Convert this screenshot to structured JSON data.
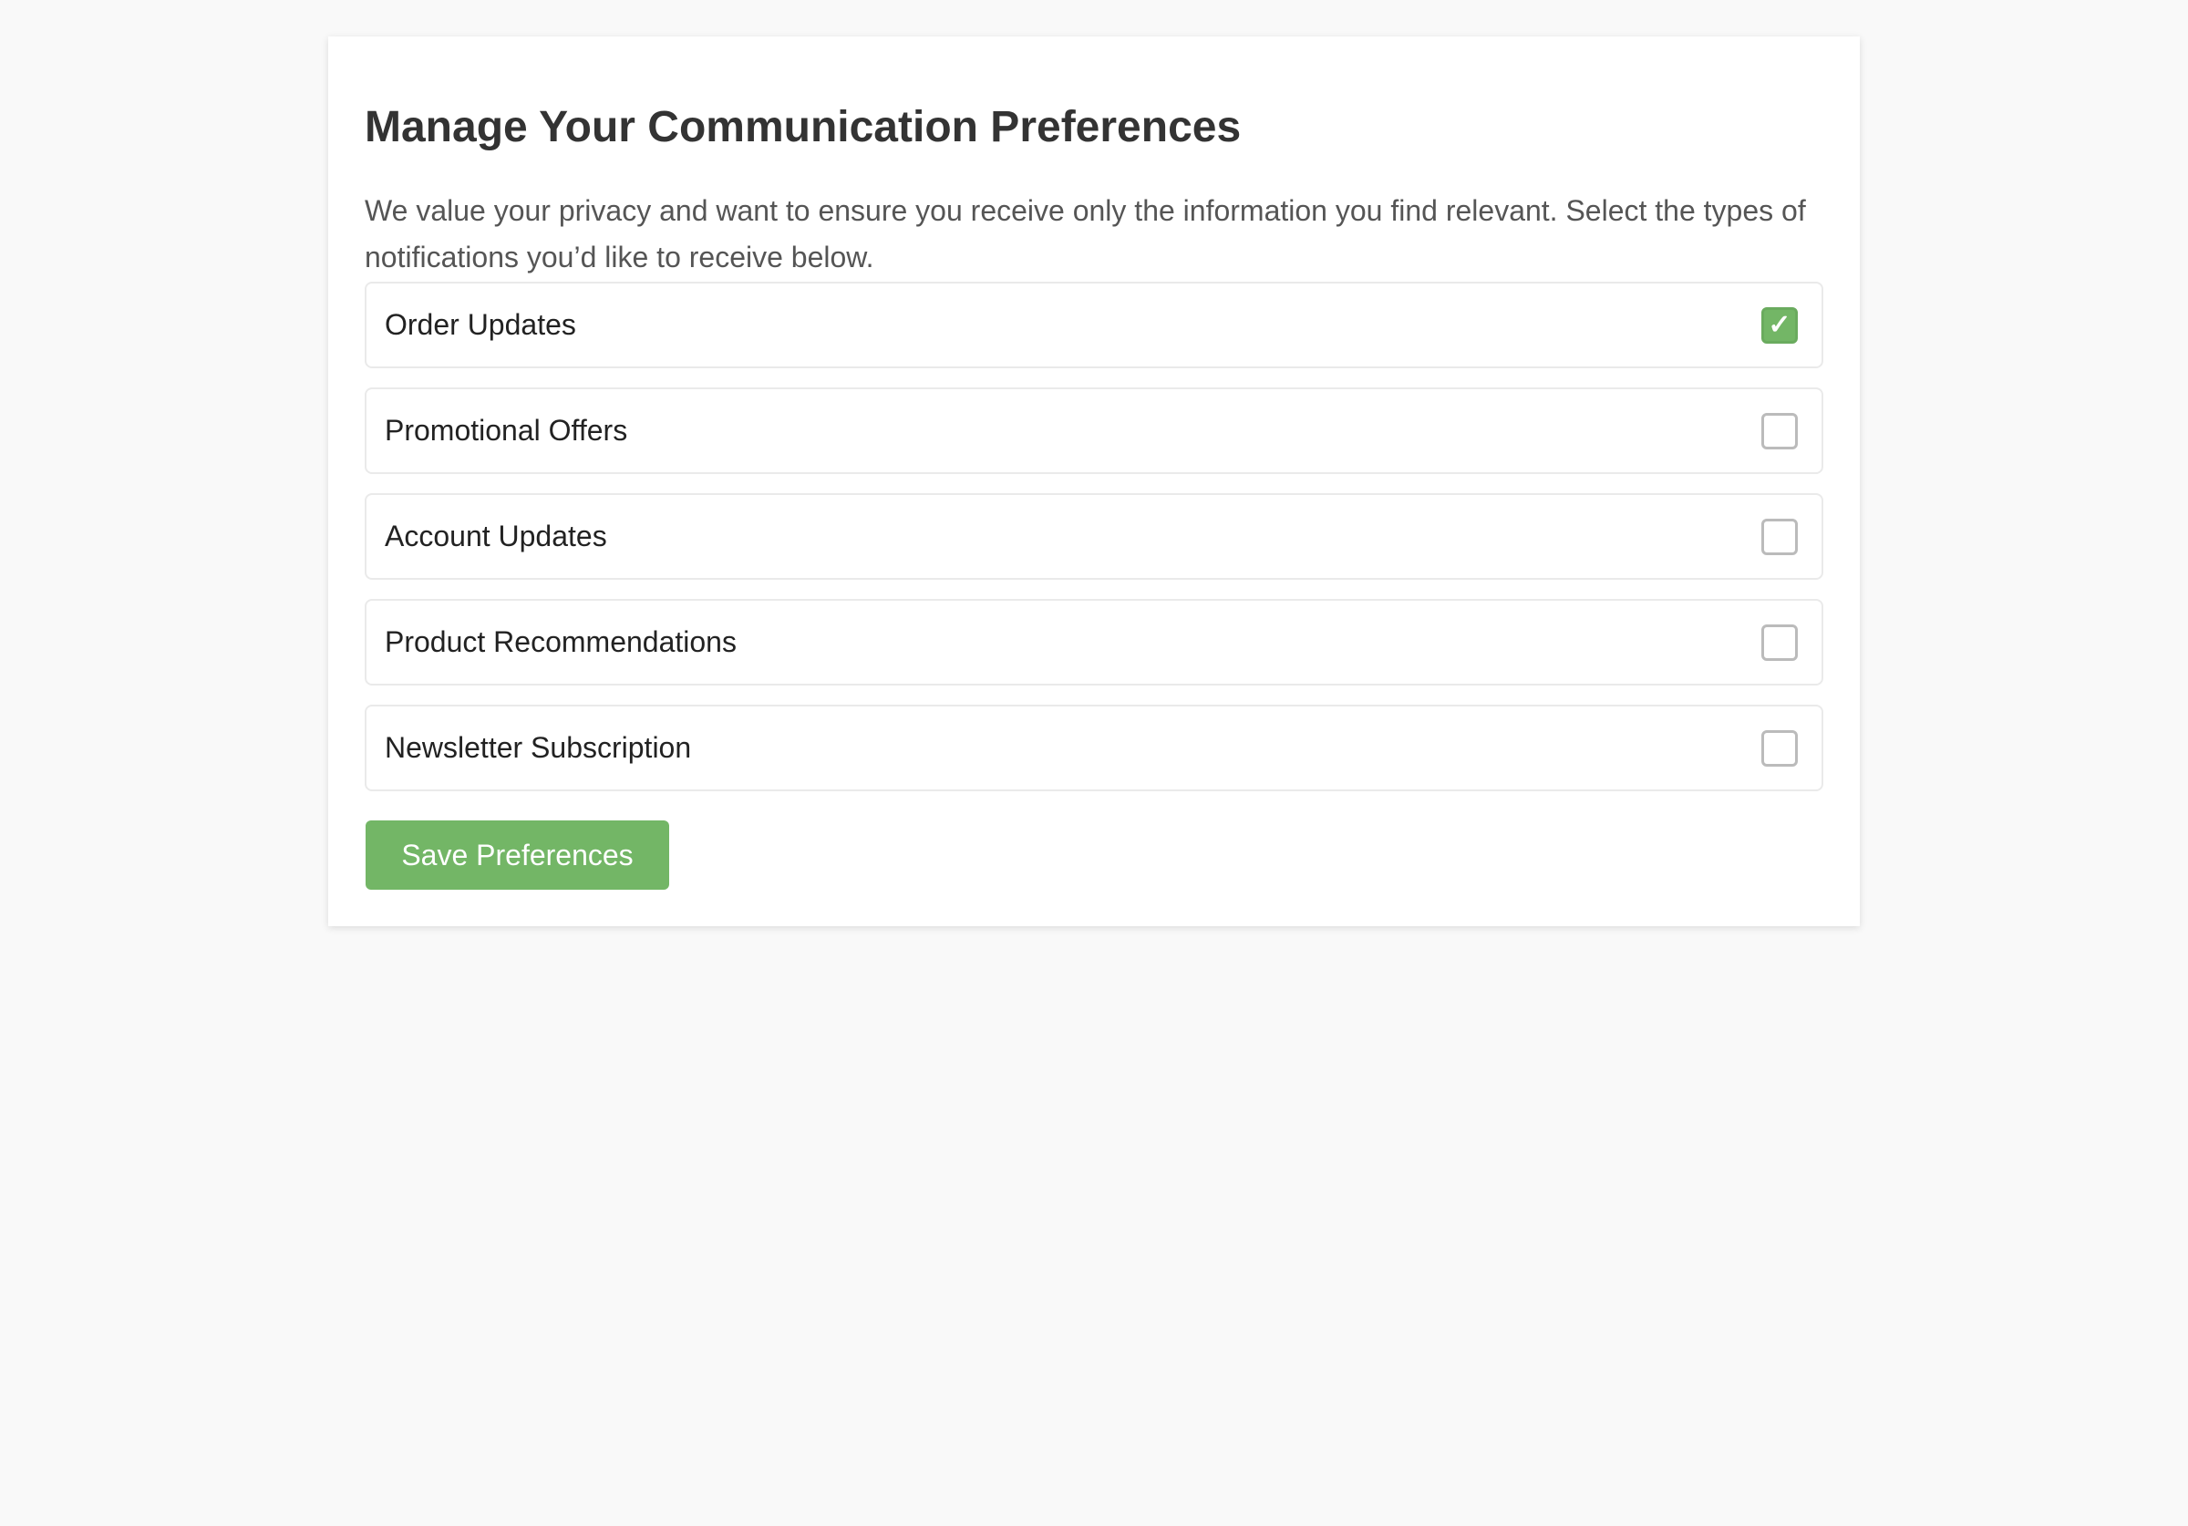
{
  "page": {
    "title": "Manage Your Communication Preferences",
    "description": "We value your privacy and want to ensure you receive only the information you find relevant. Select the types of notifications you’d like to receive below."
  },
  "preferences": [
    {
      "label": "Order Updates",
      "checked": true
    },
    {
      "label": "Promotional Offers",
      "checked": false
    },
    {
      "label": "Account Updates",
      "checked": false
    },
    {
      "label": "Product Recommendations",
      "checked": false
    },
    {
      "label": "Newsletter Subscription",
      "checked": false
    }
  ],
  "check_glyph": "✓",
  "save_label": "Save Preferences",
  "colors": {
    "accent": "#73b666",
    "background": "#f9f9f9",
    "title": "#333333"
  }
}
